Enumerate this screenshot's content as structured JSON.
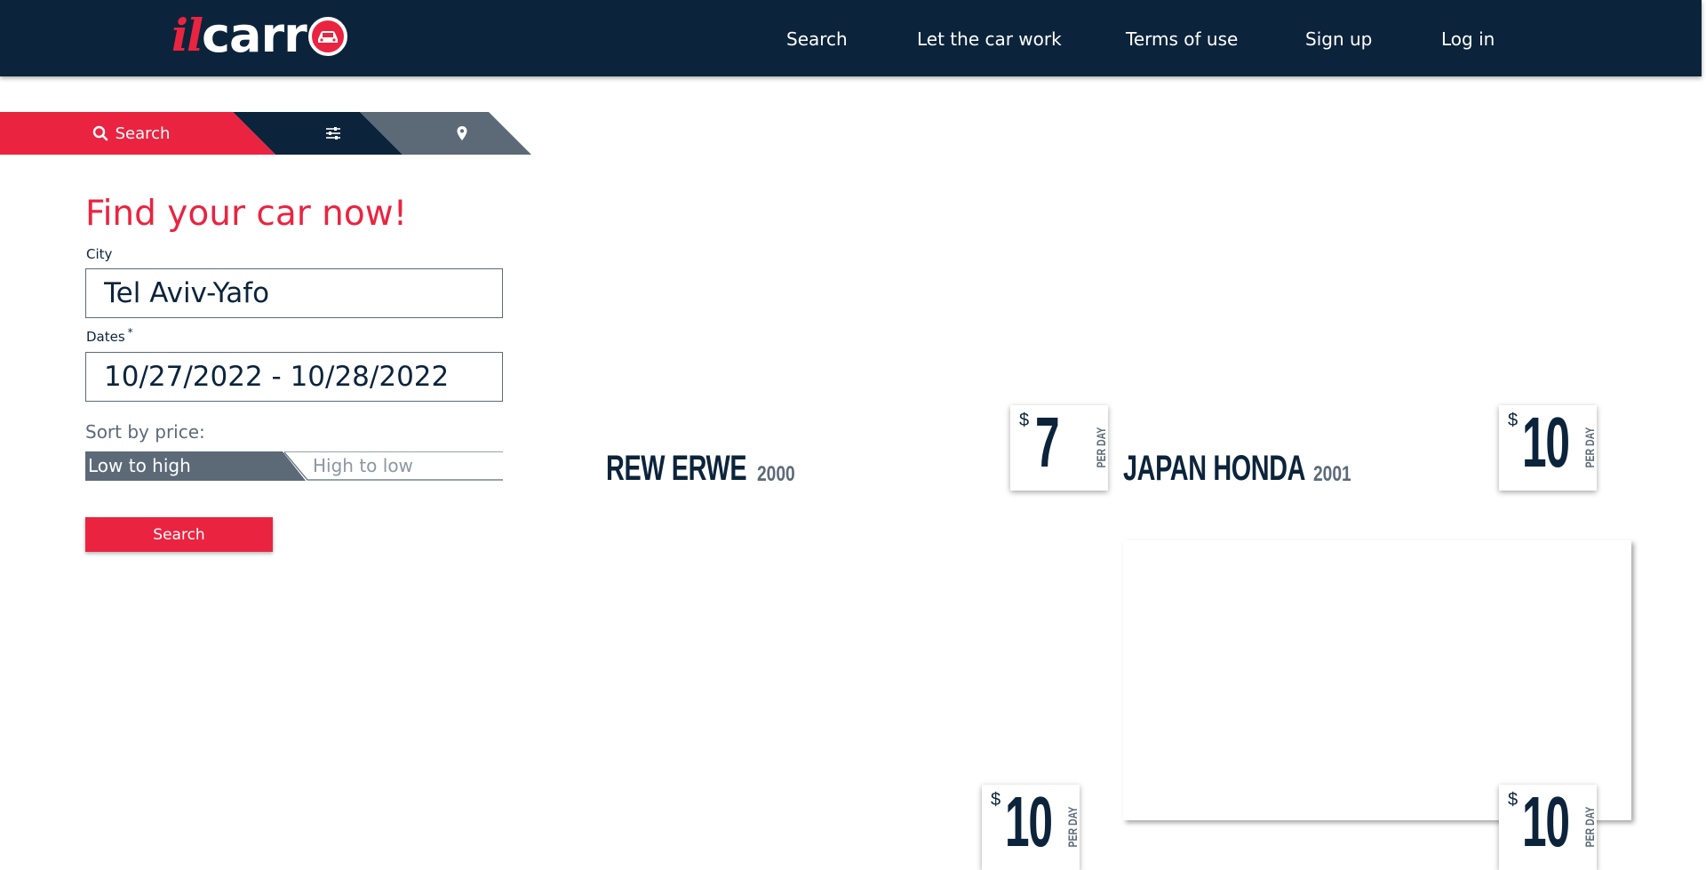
{
  "header": {
    "logo": {
      "prefix": "il",
      "main": "carr"
    },
    "nav": [
      {
        "label": "Search"
      },
      {
        "label": "Let the car work"
      },
      {
        "label": "Terms of use"
      },
      {
        "label": "Sign up"
      },
      {
        "label": "Log in"
      }
    ]
  },
  "tabs": {
    "search_label": "Search",
    "search_icon": "search-icon",
    "filters_icon": "sliders-icon",
    "map_icon": "map-pin-icon",
    "active": "Search"
  },
  "form": {
    "title": "Find your car now!",
    "city_label": "City",
    "city_value": "Tel Aviv-Yafo",
    "dates_label": "Dates",
    "dates_required_mark": "*",
    "dates_value": "10/27/2022 - 10/28/2022",
    "sort_label": "Sort by price:",
    "sort_options": [
      "Low to high",
      "High to low"
    ],
    "sort_selected": "Low to high",
    "search_button": "Search"
  },
  "cars": [
    {
      "name": "REW ERWE",
      "year": "2000",
      "currency": "$",
      "price": "7",
      "unit": "PER DAY"
    },
    {
      "name": "JAPAN HONDA",
      "year": "2001",
      "currency": "$",
      "price": "10",
      "unit": "PER DAY"
    },
    {
      "name": "",
      "year": "",
      "currency": "$",
      "price": "10",
      "unit": "PER DAY"
    },
    {
      "name": "",
      "year": "",
      "currency": "$",
      "price": "10",
      "unit": "PER DAY"
    }
  ],
  "colors": {
    "navy": "#0c243b",
    "red": "#ea2440",
    "slate": "#5c6a78"
  }
}
